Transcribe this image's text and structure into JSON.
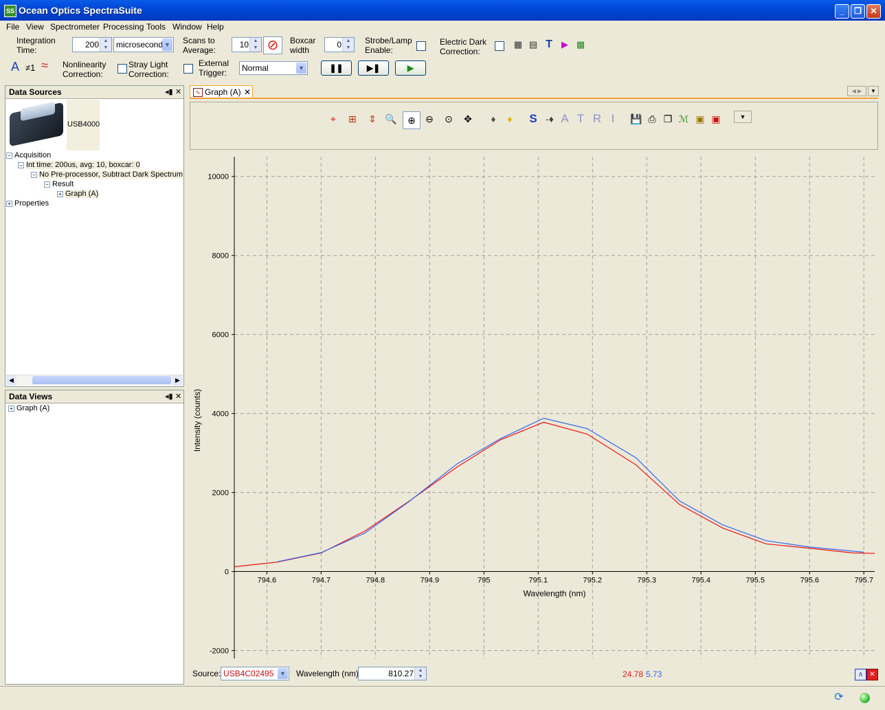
{
  "window": {
    "title": "Ocean Optics SpectraSuite",
    "app_icon": "spectrasuite-icon"
  },
  "menu": [
    "File",
    "View",
    "Spectrometer",
    "Processing",
    "Tools",
    "Window",
    "Help"
  ],
  "toolbar": {
    "integration_time_label_1": "Integration",
    "integration_time_label_2": "Time:",
    "integration_time_value": "200",
    "integration_unit": "microseconds",
    "scans_label_1": "Scans to",
    "scans_label_2": "Average:",
    "scans_value": "10",
    "boxcar_label_1": "Boxcar",
    "boxcar_label_2": "width",
    "boxcar_value": "0",
    "strobe_label_1": "Strobe/Lamp",
    "strobe_label_2": "Enable:",
    "edark_label_1": "Electric Dark",
    "edark_label_2": "Correction:",
    "nonlin_label_1": "Nonlinearity",
    "nonlin_label_2": "Correction:",
    "stray_label_1": "Stray Light",
    "stray_label_2": "Correction:",
    "ext_trigger_label_1": "External",
    "ext_trigger_label_2": "Trigger:",
    "trigger_mode": "Normal",
    "neq_label": "≠1",
    "a_label": "A"
  },
  "data_sources": {
    "title": "Data Sources",
    "device": "USB4000",
    "tree": {
      "acquisition": "Acquisition",
      "int_time": "Int time: 200us, avg: 10, boxcar: 0",
      "preproc": "No Pre-processor, Subtract Dark Spectrum",
      "result": "Result",
      "graph": "Graph (A)",
      "properties": "Properties"
    }
  },
  "data_views": {
    "title": "Data Views",
    "graph": "Graph (A)"
  },
  "graph_tab": {
    "label": "Graph (A)"
  },
  "graph_toolbar_letters": {
    "s": "S",
    "a": "A",
    "t": "T",
    "r": "R",
    "i": "I"
  },
  "status": {
    "source_label": "Source:",
    "source_value": "USB4C02495",
    "wavelength_label": "Wavelength (nm):",
    "wavelength_value": "810.27",
    "readout_red": "24.78",
    "readout_blue": "5.73"
  },
  "chart_data": {
    "type": "line",
    "xlabel": "Wavelength (nm)",
    "ylabel": "Intensity (counts)",
    "xlim": [
      794.54,
      795.72
    ],
    "ylim": [
      -2200,
      10500
    ],
    "x_ticks": [
      "794.6",
      "794.7",
      "794.8",
      "794.9",
      "795",
      "795.1",
      "795.2",
      "795.3",
      "795.4",
      "795.5",
      "795.6",
      "795.7"
    ],
    "y_ticks": [
      "-2000",
      "0",
      "2000",
      "4000",
      "6000",
      "8000",
      "10000"
    ],
    "grid": true,
    "colors": {
      "red": "#ee1111",
      "blue": "#3366ee"
    },
    "series": [
      {
        "color": "#ee1111",
        "x": [
          794.54,
          794.62,
          794.7,
          794.78,
          794.86,
          794.95,
          795.03,
          795.11,
          795.19,
          795.28,
          795.36,
          795.44,
          795.52,
          795.6,
          795.68,
          795.72
        ],
        "y": [
          120,
          240,
          470,
          1020,
          1760,
          2640,
          3330,
          3780,
          3480,
          2700,
          1700,
          1100,
          700,
          590,
          470,
          460
        ]
      },
      {
        "color": "#3366ee",
        "x": [
          794.62,
          794.7,
          794.78,
          794.86,
          794.95,
          795.03,
          795.11,
          795.19,
          795.28,
          795.36,
          795.44,
          795.52,
          795.6,
          795.7
        ],
        "y": [
          250,
          480,
          970,
          1750,
          2720,
          3360,
          3880,
          3620,
          2880,
          1790,
          1180,
          780,
          620,
          490
        ]
      }
    ]
  }
}
